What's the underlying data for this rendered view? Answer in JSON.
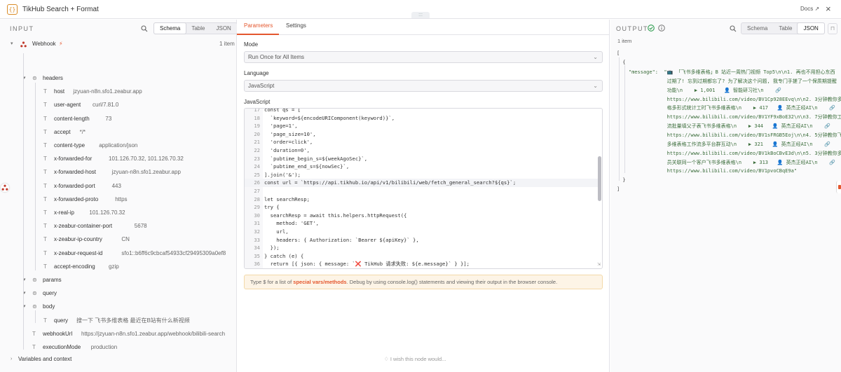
{
  "header": {
    "logo": "{}",
    "title": "TikHub Search + Format",
    "drag_handle": ":::",
    "docs_label": "Docs ↗",
    "close": "×"
  },
  "input": {
    "title": "INPUT",
    "view_tabs": [
      "Schema",
      "Table",
      "JSON"
    ],
    "active_view": "Schema",
    "node_name": "Webhook",
    "item_count": "1 item",
    "rows": [
      {
        "key": "headers",
        "value": "",
        "kind": "object"
      },
      {
        "key": "host",
        "value": "jzyuan-n8n.sfo1.zeabur.app",
        "kind": "string"
      },
      {
        "key": "user-agent",
        "value": "curl/7.81.0",
        "kind": "string"
      },
      {
        "key": "content-length",
        "value": "73",
        "kind": "string"
      },
      {
        "key": "accept",
        "value": "*/*",
        "kind": "string"
      },
      {
        "key": "content-type",
        "value": "application/json",
        "kind": "string"
      },
      {
        "key": "x-forwarded-for",
        "value": "101.126.70.32, 101.126.70.32",
        "kind": "string"
      },
      {
        "key": "x-forwarded-host",
        "value": "jzyuan-n8n.sfo1.zeabur.app",
        "kind": "string"
      },
      {
        "key": "x-forwarded-port",
        "value": "443",
        "kind": "string"
      },
      {
        "key": "x-forwarded-proto",
        "value": "https",
        "kind": "string"
      },
      {
        "key": "x-real-ip",
        "value": "101.126.70.32",
        "kind": "string"
      },
      {
        "key": "x-zeabur-container-port",
        "value": "5678",
        "kind": "string"
      },
      {
        "key": "x-zeabur-ip-country",
        "value": "CN",
        "kind": "string"
      },
      {
        "key": "x-zeabur-request-id",
        "value": "sfo1::b6ff6c9cbcaf54933cf29495309a0ef8",
        "kind": "string"
      },
      {
        "key": "accept-encoding",
        "value": "gzip",
        "kind": "string"
      },
      {
        "key": "params",
        "value": "",
        "kind": "object"
      },
      {
        "key": "query",
        "value": "",
        "kind": "object"
      },
      {
        "key": "body",
        "value": "",
        "kind": "object"
      },
      {
        "key": "query",
        "value": "搜一下 飞书多维表格 最近在B站有什么新视频",
        "kind": "string"
      },
      {
        "key": "webhookUrl",
        "value": "https://jzyuan-n8n.sfo1.zeabur.app/webhook/bilibili-search",
        "kind": "string"
      },
      {
        "key": "executionMode",
        "value": "production",
        "kind": "string"
      }
    ],
    "variables_label": "Variables and context"
  },
  "params": {
    "tabs": [
      "Parameters",
      "Settings"
    ],
    "active_tab": "Parameters",
    "mode_label": "Mode",
    "mode_value": "Run Once for All Items",
    "language_label": "Language",
    "language_value": "JavaScript",
    "code_label": "JavaScript",
    "code_lines": [
      {
        "n": "17",
        "t": "const qs = ["
      },
      {
        "n": "18",
        "t": "  `keyword=${encodeURIComponent(keyword)}`,"
      },
      {
        "n": "19",
        "t": "  'page=1',"
      },
      {
        "n": "20",
        "t": "  'page_size=10',"
      },
      {
        "n": "21",
        "t": "  'order=click',"
      },
      {
        "n": "22",
        "t": "  'duration=0',"
      },
      {
        "n": "23",
        "t": "  `pubtime_begin_s=${weekAgoSec}`,"
      },
      {
        "n": "24",
        "t": "  `pubtime_end_s=${nowSec}`,"
      },
      {
        "n": "25",
        "t": "].join('&');"
      },
      {
        "n": "26",
        "t": "const url = `https://api.tikhub.io/api/v1/bilibili/web/fetch_general_search?${qs}`;"
      },
      {
        "n": "27",
        "t": ""
      },
      {
        "n": "28",
        "t": "let searchResp;"
      },
      {
        "n": "29",
        "t": "try {"
      },
      {
        "n": "30",
        "t": "  searchResp = await this.helpers.httpRequest({"
      },
      {
        "n": "31",
        "t": "    method: 'GET',"
      },
      {
        "n": "32",
        "t": "    url,"
      },
      {
        "n": "33",
        "t": "    headers: { Authorization: `Bearer ${apiKey}` },"
      },
      {
        "n": "34",
        "t": "  });"
      },
      {
        "n": "35",
        "t": "} catch (e) {"
      },
      {
        "n": "36",
        "t": "  return [{ json: { message: `❌ TikHub 请求失败: ${e.message}` } }];"
      }
    ],
    "hint_prefix": "Type $ for a list of ",
    "hint_link": "special vars/methods",
    "hint_suffix": ". Debug by using console.log() statements and viewing their output in the browser console.",
    "wish_label": "I wish this node would..."
  },
  "output": {
    "title": "OUTPUT",
    "view_tabs": [
      "Schema",
      "Table",
      "JSON"
    ],
    "active_view": "JSON",
    "item_count": "1 item",
    "json_lines": [
      "[",
      "  {",
      "    \"message\":  \"📺 「飞书多维表格」B 站近一周热门视频 Top5\\n\\n1. 再也不用担心东西",
      "                 过期了! 忘到过期都忘了? 为了解决这个问题, 我专门手搓了一个保质期提醒",
      "                 功能\\n    ▶ 1,001   👤 智能研习社\\n    🔗",
      "                 https://www.bilibili.com/video/BV1Cp928EEvq\\n\\n2. 3分钟教你多表",
      "                 格多形式统计工时飞书多维表格\\n    ▶ 417   👤 英杰正经AI\\n    🔗",
      "                 https://www.bilibili.com/video/BV1YF9xBoE32\\n\\n3. 7分钟教你工作",
      "                 流批量填父子表飞书多维表格\\n    ▶ 344   👤 英杰正经AI\\n    🔗",
      "                 https://www.bilibili.com/video/BV1sFRGB5Eoj\\n\\n4. 5分钟教你飞书",
      "                 多维表格工作流多平台群互动\\n    ▶ 321   👤 英杰正经AI\\n    🔗",
      "                 https://www.bilibili.com/video/BV1kBoCBvE3d\\n\\n5. 3分钟教你多人",
      "                 员关联同一个客户飞书多维表格\\n    ▶ 313   👤 英杰正经AI\\n    🔗",
      "                 https://www.bilibili.com/video/BV1pvoCBqE9a\"",
      "  }",
      "]"
    ]
  },
  "colors": {
    "accent": "#e4572e",
    "success": "#2e9d4f",
    "hint_bg": "#fdf4e6"
  }
}
